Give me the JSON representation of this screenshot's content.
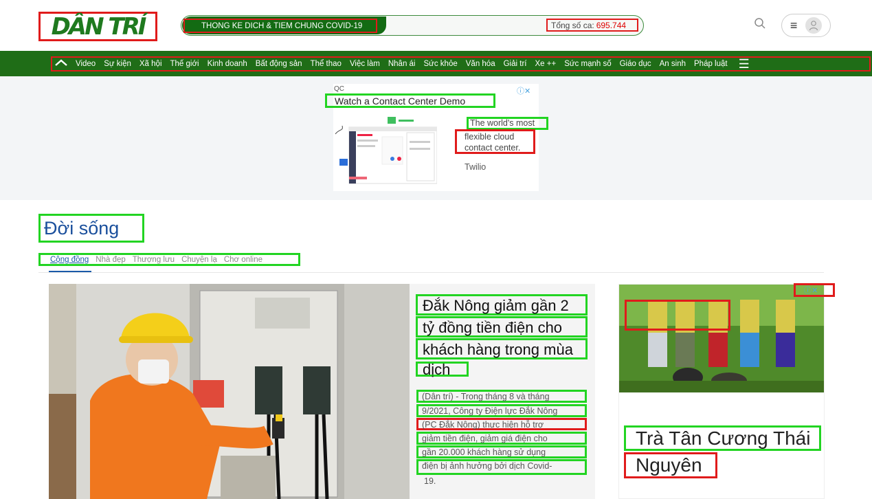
{
  "header": {
    "logo_text": "DÂN TRÍ",
    "covid_title": "THONG KE DICH & TIEM CHUNG COVID-19",
    "covid_count_label": "Tổng số ca:",
    "covid_count_value": "695.744",
    "search_icon": "search-icon",
    "menu_icon": "hamburger-icon",
    "user_icon": "user-avatar-icon"
  },
  "nav": {
    "home_icon": "home-icon",
    "items": [
      "Video",
      "Sự kiện",
      "Xã hội",
      "Thế giới",
      "Kinh doanh",
      "Bất động sản",
      "Thể thao",
      "Việc làm",
      "Nhân ái",
      "Sức khỏe",
      "Văn hóa",
      "Giải trí",
      "Xe ++",
      "Sức mạnh số",
      "Giáo dục",
      "An sinh",
      "Pháp luật"
    ],
    "more_icon": "menu-icon"
  },
  "ad_top": {
    "qc_label": "QC",
    "title": "Watch a Contact Center Demo",
    "line1": "The world's most",
    "line2": "flexible cloud",
    "line3": "contact center.",
    "brand": "Twilio"
  },
  "section": {
    "title": "Đời sống",
    "tabs": [
      "Cộng đồng",
      "Nhà đẹp",
      "Thượng lưu",
      "Chuyện lạ",
      "Chơ online"
    ]
  },
  "article": {
    "headline_lines": [
      "Đắk Nông giảm gần 2",
      "tỷ đồng tiền điện cho",
      "khách hàng trong mùa",
      "dịch"
    ],
    "summary_lines": [
      "(Dân trí) - Trong tháng 8 và tháng",
      "9/2021, Công ty Điện lực Đắk Nông",
      "(PC Đắk Nông) thực hiện hỗ trợ",
      "giảm tiền điện, giảm giá điện cho",
      "gần 20.000 khách hàng sử dụng",
      "điện bị ảnh hưởng bởi dịch Covid-",
      "19."
    ]
  },
  "ad_right": {
    "title_line1": "Trà Tân Cương Thái",
    "title_line2": "Nguyên"
  },
  "colors": {
    "brand_green": "#1f6d17",
    "link_blue": "#1a4f9c",
    "count_red": "#dd0000"
  }
}
